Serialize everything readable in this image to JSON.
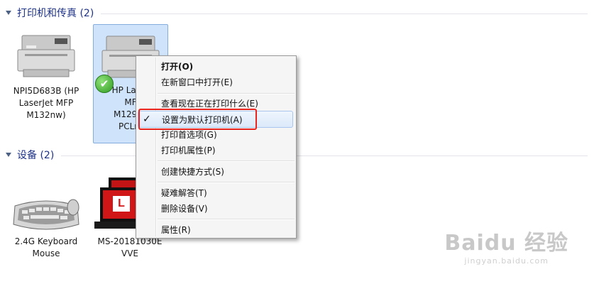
{
  "groups": {
    "printers": {
      "title": "打印机和传真 (2)"
    },
    "devices": {
      "title": "设备 (2)"
    }
  },
  "printers": [
    {
      "label": "NPI5D683B (HP\nLaserJet MFP\nM132nw)",
      "icon": "printer-mfp-icon",
      "selected": false
    },
    {
      "label": "HP Laser\nMF\nM129-M\nPCLm",
      "icon": "printer-mfp-icon",
      "selected": true,
      "default_badge": "✔"
    }
  ],
  "devices": [
    {
      "label": "2.4G Keyboard\nMouse",
      "icon": "keyboard-icon"
    },
    {
      "label": "MS-20181030E\nVVE",
      "icon": "computer-icon",
      "logo_letter": "L"
    }
  ],
  "context_menu": {
    "items": [
      {
        "label": "打开(O)",
        "bold": true
      },
      {
        "label": "在新窗口中打开(E)"
      },
      {
        "label": "查看现在正在打印什么(E)"
      },
      {
        "label": "设置为默认打印机(A)",
        "checked": true,
        "check_glyph": "✓"
      },
      {
        "label": "打印首选项(G)"
      },
      {
        "label": "打印机属性(P)"
      },
      {
        "label": "创建快捷方式(S)"
      },
      {
        "label": "疑难解答(T)"
      },
      {
        "label": "删除设备(V)"
      },
      {
        "label": "属性(R)"
      }
    ]
  },
  "watermark": {
    "logo": "Baidu 经验",
    "sub": "jingyan.baidu.com"
  },
  "colors": {
    "highlight": "#e8251f",
    "selection": "#cfe3fb",
    "group_title": "#1e3287"
  }
}
